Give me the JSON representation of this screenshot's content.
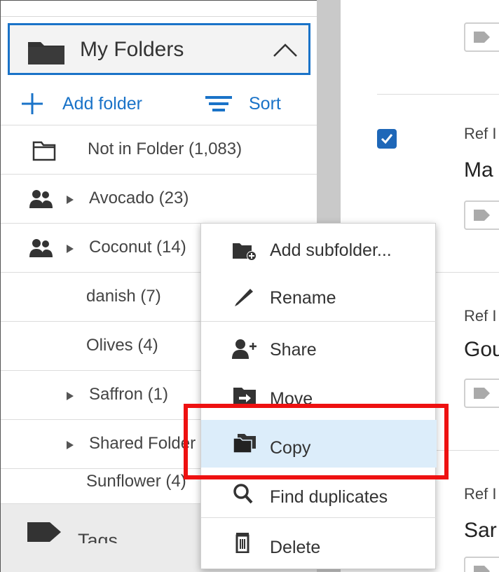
{
  "sidebar": {
    "header_title": "My Folders",
    "add_folder_label": "Add folder",
    "sort_label": "Sort",
    "folders": [
      {
        "label": "Not in Folder (1,083)"
      },
      {
        "label": "Avocado (23)"
      },
      {
        "label": "Coconut (14)"
      },
      {
        "label": "danish (7)"
      },
      {
        "label": "Olives (4)"
      },
      {
        "label": "Saffron (1)"
      },
      {
        "label": "Shared Folder"
      },
      {
        "label": "Sunflower (4)"
      }
    ],
    "tags_label": "Tags"
  },
  "context_menu": {
    "items": [
      {
        "label": "Add subfolder...",
        "icon": "add-subfolder-icon"
      },
      {
        "label": "Rename",
        "icon": "pencil-icon"
      },
      {
        "label": "Share",
        "icon": "add-person-icon"
      },
      {
        "label": "Move",
        "icon": "move-folder-icon"
      },
      {
        "label": "Copy",
        "icon": "copy-folder-icon"
      },
      {
        "label": "Find duplicates",
        "icon": "search-icon"
      },
      {
        "label": "Delete",
        "icon": "trash-icon"
      }
    ],
    "highlighted": "Copy"
  },
  "content": {
    "items": [
      {
        "ref": "Ref I",
        "title": "Ma"
      },
      {
        "ref": "Ref I",
        "title": "Gou"
      },
      {
        "ref": "Ref I",
        "title": "Sar"
      }
    ]
  },
  "colors": {
    "accent": "#1a73c8",
    "annotation_red": "#ee1111",
    "menu_highlight": "#dcedfa",
    "sidebar_gray_bar": "#c9c9c9"
  }
}
